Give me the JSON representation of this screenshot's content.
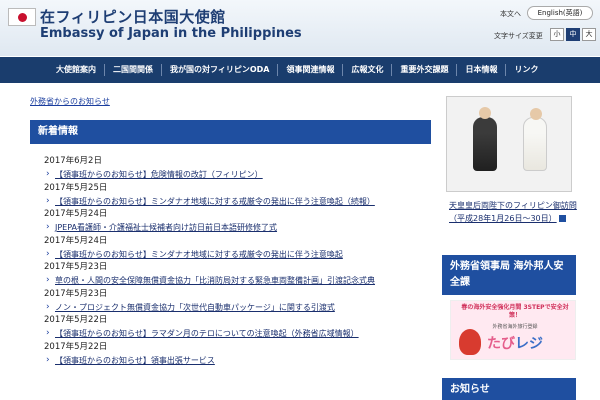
{
  "header": {
    "title_jp": "在フィリピン日本国大使館",
    "title_en": "Embassy of Japan in the Philippines",
    "lang_label": "本文へ",
    "lang_button": "English(英語)",
    "font_size_label": "文字サイズ変更",
    "font_sizes": [
      "小",
      "中",
      "大"
    ]
  },
  "nav": {
    "items": [
      "大使館案内",
      "二国間関係",
      "我が国の対フィリピンODA",
      "領事関連情報",
      "広報文化",
      "重要外交課題",
      "日本情報",
      "リンク"
    ]
  },
  "breadcrumb": "外務省からのお知らせ",
  "news": {
    "heading": "新着情報",
    "entries": [
      {
        "date": "2017年6月2日",
        "title": "【領事班からのお知らせ】危険情報の改訂（フィリピン）"
      },
      {
        "date": "2017年5月25日",
        "title": "【領事班からのお知らせ】ミンダナオ地域に対する戒厳令の発出に伴う注意喚起（続報）"
      },
      {
        "date": "2017年5月24日",
        "title": "JPEPA看護師・介護福祉士候補者向け訪日前日本語研修修了式"
      },
      {
        "date": "2017年5月24日",
        "title": "【領事班からのお知らせ】ミンダナオ地域に対する戒厳令の発出に伴う注意喚起"
      },
      {
        "date": "2017年5月23日",
        "title": "草の根・人間の安全保障無償資金協力「比消防局対する緊急車両整備計画」引渡記念式典"
      },
      {
        "date": "2017年5月23日",
        "title": "ノン・プロジェクト無償資金協力「次世代自動車パッケージ」に関する引渡式"
      },
      {
        "date": "2017年5月22日",
        "title": "【領事班からのお知らせ】ラマダン月のテロについての注意喚起（外務省広域情報）"
      },
      {
        "date": "2017年5月22日",
        "title": "【領事班からのお知らせ】領事出張サービス"
      }
    ]
  },
  "sidebar": {
    "photo_caption": "天皇皇后両陛下のフィリピン御訪問（平成28年1月26日〜30日）",
    "consular_heading": "外務省領事局 海外邦人安全課",
    "banner_top": "春の海外安全強化月間 3STEPで安全対策！",
    "banner_mid": "外務省海外旅行登録",
    "banner_logo_a": "たび",
    "banner_logo_b": "レジ",
    "notice_heading": "お知らせ"
  },
  "colors": {
    "navy": "#1a3d6d",
    "section_blue": "#1f4fa0",
    "link": "#1a2f6e"
  }
}
